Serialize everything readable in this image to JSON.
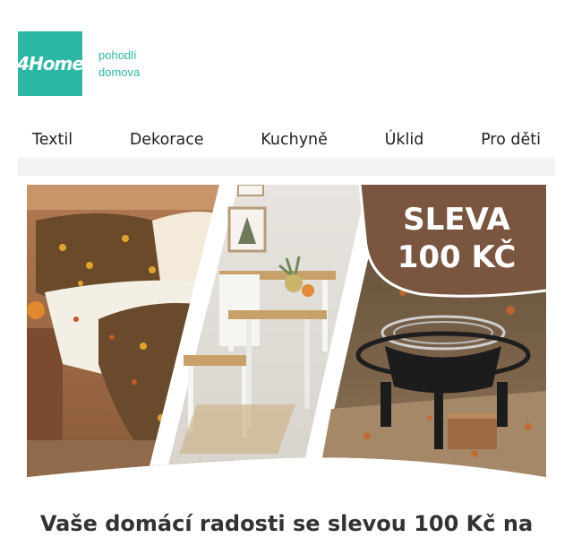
{
  "brand": {
    "logo_text": "4Home",
    "tagline_line1": "pohodlí",
    "tagline_line2": "domova",
    "color": "#2bb6a5"
  },
  "nav": {
    "items": [
      {
        "label": "Textil"
      },
      {
        "label": "Dekorace"
      },
      {
        "label": "Kuchyně"
      },
      {
        "label": "Úklid"
      },
      {
        "label": "Pro děti"
      }
    ]
  },
  "hero": {
    "badge_line1": "SLEVA",
    "badge_line2": "100 KČ",
    "badge_color": "#7a5640"
  },
  "headline": "Vaše domácí radosti se slevou 100 Kč na"
}
